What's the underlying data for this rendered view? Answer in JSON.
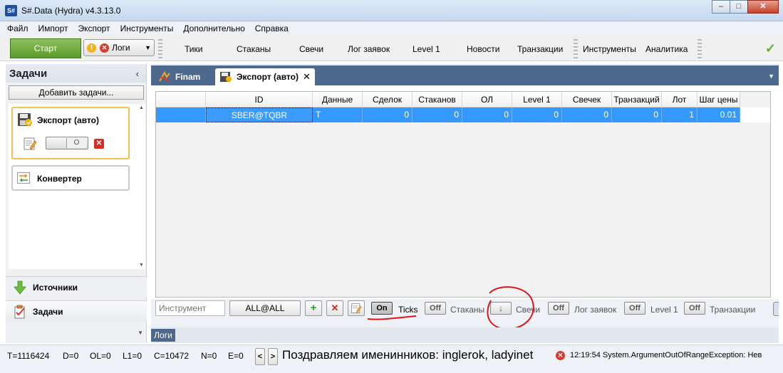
{
  "window": {
    "title": "S#.Data (Hydra) v4.3.13.0",
    "icon_text": "S#",
    "min": "–",
    "max": "□",
    "close": "✕"
  },
  "menu": [
    "Файл",
    "Импорт",
    "Экспорт",
    "Инструменты",
    "Дополнительно",
    "Справка"
  ],
  "toolbar": {
    "start": "Старт",
    "logs": "Логи",
    "logs_warn": "!",
    "logs_err": "✕",
    "logs_caret": "▼",
    "tabs": [
      "Тики",
      "Стаканы",
      "Свечи",
      "Лог заявок",
      "Level 1",
      "Новости",
      "Транзакции",
      "Инструменты",
      "Аналитика"
    ],
    "status_check": "✓"
  },
  "left": {
    "title": "Задачи",
    "collapse": "‹",
    "add_task": "Добавить задачи...",
    "tasks": [
      {
        "name": "Экспорт (авто)",
        "toggle_knob": "O",
        "delete": "✕"
      },
      {
        "name": "Конвертер"
      }
    ],
    "scroll_up": "▲",
    "scroll_down": "▼",
    "nav": [
      {
        "label": "Источники"
      },
      {
        "label": "Задачи"
      }
    ],
    "bottom_caret": "▼"
  },
  "tabs": [
    {
      "label": "Finam"
    },
    {
      "label": "Экспорт (авто)",
      "close": "✕"
    }
  ],
  "tabs_menu": "▼",
  "grid": {
    "columns": [
      "",
      "ID",
      "Данные",
      "Сделок",
      "Стаканов",
      "ОЛ",
      "Level 1",
      "Свечек",
      "Транзакций",
      "Лот",
      "Шаг цены"
    ],
    "rows": [
      [
        "",
        "SBER@TQBR",
        "T",
        "0",
        "0",
        "0",
        "0",
        "0",
        "0",
        "1",
        "0.01"
      ]
    ]
  },
  "filter": {
    "instrument_placeholder": "Инструмент",
    "all_button": "ALL@ALL",
    "add": "+",
    "del": "✕",
    "edit": "✎",
    "toggles": [
      {
        "state": "On",
        "label": "Ticks"
      },
      {
        "state": "Off",
        "label": "Стаканы"
      },
      {
        "state": "↓",
        "label": "Свечи"
      },
      {
        "state": "Off",
        "label": "Лог заявок"
      },
      {
        "state": "Off",
        "label": "Level 1"
      },
      {
        "state": "Off",
        "label": "Транзакции"
      }
    ]
  },
  "logs_tab": "Логи",
  "status": {
    "t": "T=1116424",
    "d": "D=0",
    "ol": "OL=0",
    "l1": "L1=0",
    "c": "C=10472",
    "n": "N=0",
    "e": "E=0",
    "prev": "<",
    "next": ">",
    "ticker": "Поздравляем именинников: inglerok, ladyinet",
    "err_dot": "✕",
    "error": "12:19:54  System.ArgumentOutOfRangeException: Нев"
  },
  "colors": {
    "selection": "#3399ff",
    "start": "#5a9a2b",
    "tabbar": "#4d6a8e",
    "ink": "#e0141c"
  }
}
